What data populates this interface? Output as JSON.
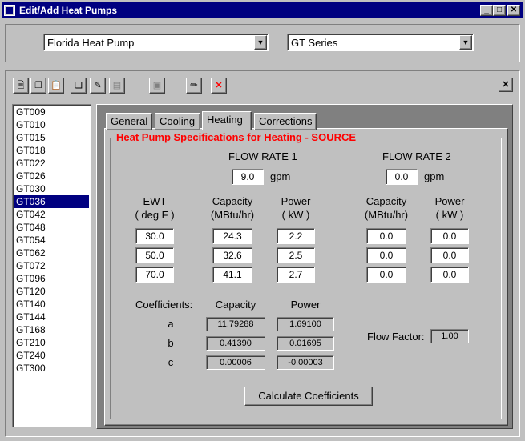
{
  "window": {
    "title": "Edit/Add Heat Pumps",
    "min": "_",
    "max": "□",
    "close": "✕"
  },
  "selectors": {
    "manufacturer": "Florida Heat Pump",
    "series": "GT Series"
  },
  "toolbar": {
    "close_panel": "✕",
    "delete_icon": "✕"
  },
  "models": [
    "GT009",
    "GT010",
    "GT015",
    "GT018",
    "GT022",
    "GT026",
    "GT030",
    "GT036",
    "GT042",
    "GT048",
    "GT054",
    "GT062",
    "GT072",
    "GT096",
    "GT120",
    "GT140",
    "GT144",
    "GT168",
    "GT210",
    "GT240",
    "GT300"
  ],
  "selected_model": "GT036",
  "tabs": [
    {
      "label": "General"
    },
    {
      "label": "Cooling"
    },
    {
      "label": "Heating"
    },
    {
      "label": "Corrections"
    }
  ],
  "active_tab": "Heating",
  "heating": {
    "group_title": "Heat Pump Specifications for Heating - SOURCE",
    "flow1": {
      "label": "FLOW RATE 1",
      "value": "9.0",
      "unit": "gpm"
    },
    "flow2": {
      "label": "FLOW RATE 2",
      "value": "0.0",
      "unit": "gpm"
    },
    "headers": {
      "ewt": "EWT",
      "ewt_unit": "( deg F )",
      "capacity": "Capacity",
      "capacity_unit": "(MBtu/hr)",
      "power": "Power",
      "power_unit": "( kW )"
    },
    "ewt": [
      "30.0",
      "50.0",
      "70.0"
    ],
    "cap1": [
      "24.3",
      "32.6",
      "41.1"
    ],
    "pow1": [
      "2.2",
      "2.5",
      "2.7"
    ],
    "cap2": [
      "0.0",
      "0.0",
      "0.0"
    ],
    "pow2": [
      "0.0",
      "0.0",
      "0.0"
    ],
    "coefficients": {
      "label": "Coefficients:",
      "capacity_label": "Capacity",
      "power_label": "Power",
      "rows": [
        {
          "name": "a",
          "capacity": "11.79288",
          "power": "1.69100"
        },
        {
          "name": "b",
          "capacity": "0.41390",
          "power": "0.01695"
        },
        {
          "name": "c",
          "capacity": "0.00006",
          "power": "-0.00003"
        }
      ]
    },
    "flow_factor": {
      "label": "Flow Factor:",
      "value": "1.00"
    },
    "calculate_label": "Calculate Coefficients"
  }
}
